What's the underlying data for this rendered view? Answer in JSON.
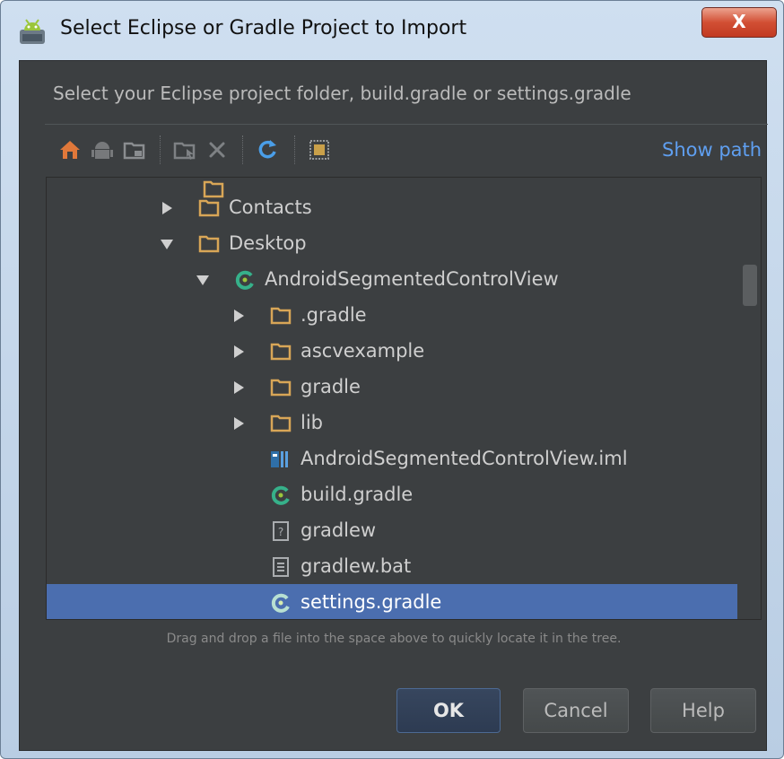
{
  "window": {
    "title": "Select Eclipse or Gradle Project to Import",
    "close_glyph": "X"
  },
  "description": "Select your Eclipse project folder, build.gradle or settings.gradle",
  "toolbar": {
    "icons": [
      "home-icon",
      "android-icon",
      "project-folder-icon",
      "new-folder-icon",
      "delete-icon",
      "refresh-icon",
      "show-hidden-icon"
    ],
    "show_path_label": "Show path"
  },
  "tree": {
    "items": [
      {
        "label": "Contacts",
        "type": "folder",
        "expanded": false
      },
      {
        "label": "Desktop",
        "type": "folder",
        "expanded": true
      },
      {
        "label": "AndroidSegmentedControlView",
        "type": "gradle-project",
        "expanded": true
      },
      {
        "label": ".gradle",
        "type": "folder",
        "expanded": false
      },
      {
        "label": "ascvexample",
        "type": "folder",
        "expanded": false
      },
      {
        "label": "gradle",
        "type": "folder",
        "expanded": false
      },
      {
        "label": "lib",
        "type": "folder",
        "expanded": false
      },
      {
        "label": "AndroidSegmentedControlView.iml",
        "type": "iml-file"
      },
      {
        "label": "build.gradle",
        "type": "gradle-file"
      },
      {
        "label": "gradlew",
        "type": "script-file"
      },
      {
        "label": "gradlew.bat",
        "type": "text-file"
      },
      {
        "label": "settings.gradle",
        "type": "gradle-file",
        "selected": true
      }
    ]
  },
  "hint": "Drag and drop a file into the space above to quickly locate it in the tree.",
  "buttons": {
    "ok": "OK",
    "cancel": "Cancel",
    "help": "Help"
  },
  "colors": {
    "content_bg": "#3c3f41",
    "selection": "#4b6eaf",
    "link": "#5f9ff0",
    "folder": "#d8a657",
    "gradle": "#36b18a"
  }
}
